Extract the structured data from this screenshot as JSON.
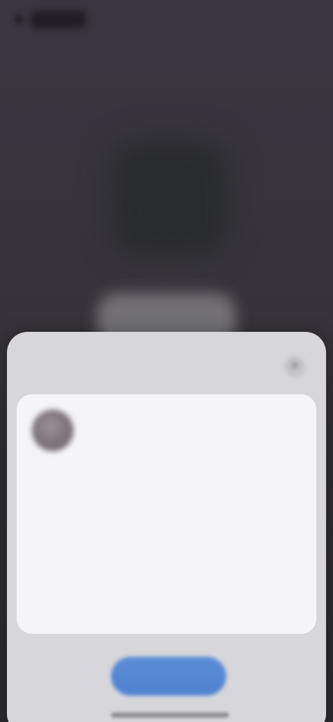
{
  "status_bar": {
    "icons": [
      "signal-icon",
      "status-block"
    ]
  },
  "background": {
    "blurred_icon": "app-icon"
  },
  "sheet": {
    "title": "",
    "close_icon": "close-icon",
    "close_glyph": "✕",
    "profile": {
      "avatar_icon": "avatar",
      "name": "",
      "subtitle": ""
    },
    "fields": [
      "",
      ""
    ],
    "body_text": "",
    "primary_button_label": ""
  },
  "colors": {
    "accent": "#5b8dd6",
    "sheet_background": "#d7d6da",
    "card_background": "#f5f4f7",
    "page_background": "#37343b"
  }
}
